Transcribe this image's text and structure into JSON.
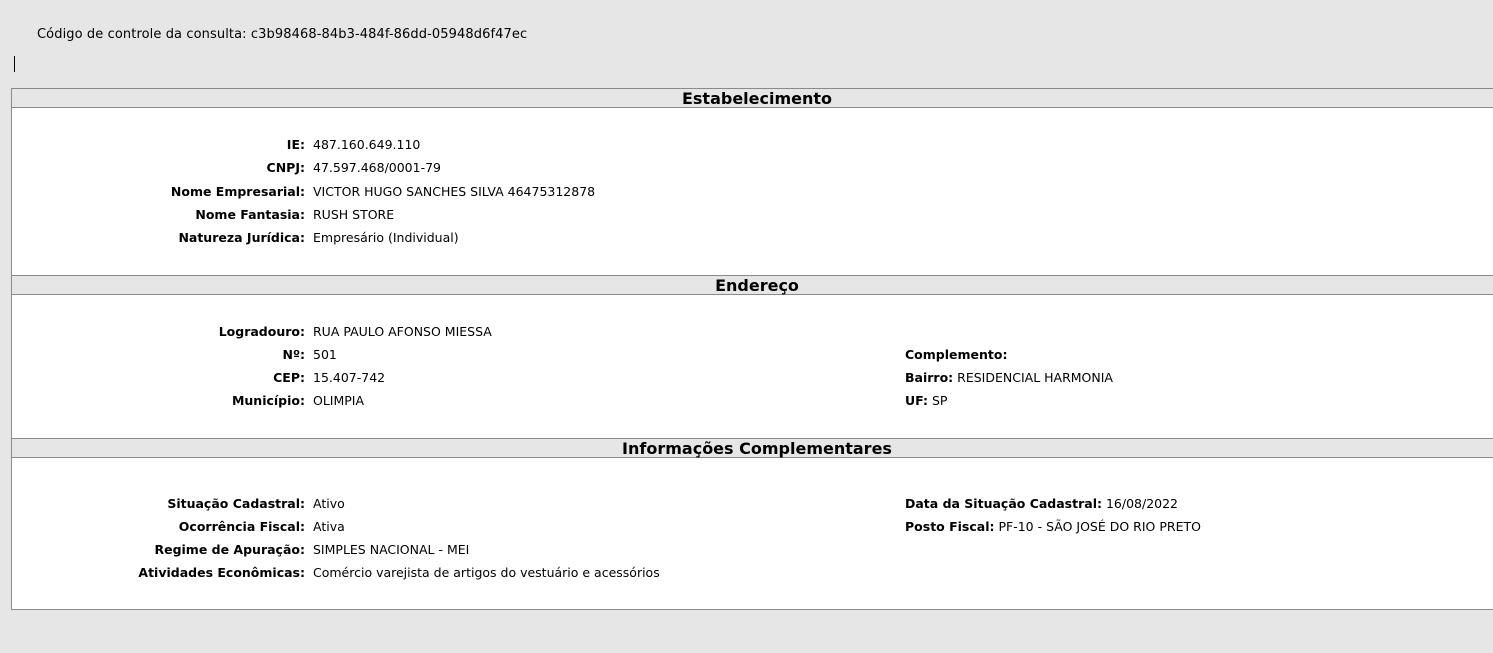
{
  "header": {
    "control_label": "Código de controle da consulta:",
    "control_code": "c3b98468-84b3-484f-86dd-05948d6f47ec"
  },
  "estabelecimento": {
    "title": "Estabelecimento",
    "rows": [
      {
        "label": "IE:",
        "value": "487.160.649.110"
      },
      {
        "label": "CNPJ:",
        "value": "47.597.468/0001-79"
      },
      {
        "label": "Nome Empresarial:",
        "value": "VICTOR HUGO SANCHES SILVA 46475312878"
      },
      {
        "label": "Nome Fantasia:",
        "value": "RUSH STORE"
      },
      {
        "label": "Natureza Jurídica:",
        "value": "Empresário (Individual)"
      }
    ]
  },
  "endereco": {
    "title": "Endereço",
    "left": [
      {
        "label": "Logradouro:",
        "value": "RUA PAULO AFONSO MIESSA"
      },
      {
        "label": "Nº:",
        "value": "501"
      },
      {
        "label": "CEP:",
        "value": "15.407-742"
      },
      {
        "label": "Município:",
        "value": "OLIMPIA"
      }
    ],
    "right": [
      {
        "label": "Complemento:",
        "value": ""
      },
      {
        "label": "Bairro:",
        "value": "RESIDENCIAL HARMONIA"
      },
      {
        "label": "UF:",
        "value": "SP"
      }
    ]
  },
  "info": {
    "title": "Informações Complementares",
    "left": [
      {
        "label": "Situação Cadastral:",
        "value": "Ativo"
      },
      {
        "label": "Ocorrência Fiscal:",
        "value": "Ativa"
      },
      {
        "label": "Regime de Apuração:",
        "value": "SIMPLES NACIONAL - MEI"
      },
      {
        "label": "Atividades Econômicas:",
        "value": "Comércio varejista de artigos do vestuário e acessórios"
      }
    ],
    "right": [
      {
        "label": "Data da Situação Cadastral:",
        "value": "16/08/2022"
      },
      {
        "label": "Posto Fiscal:",
        "value": "PF-10 - SÃO JOSÉ DO RIO PRETO"
      }
    ]
  }
}
